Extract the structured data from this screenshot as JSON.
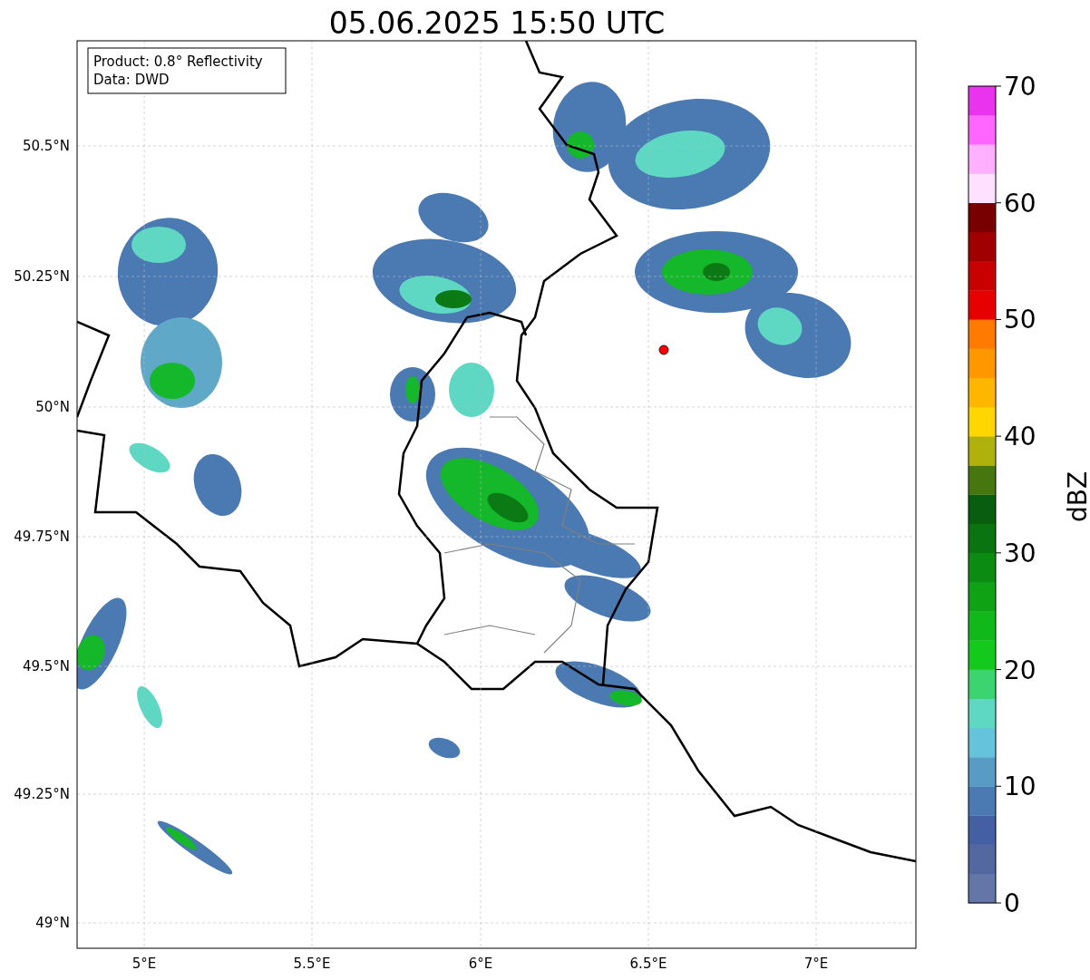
{
  "title": "05.06.2025 15:50 UTC",
  "info_box": [
    "Product: 0.8° Reflectivity",
    "Data: DWD"
  ],
  "x_ticks": [
    "5°E",
    "5.5°E",
    "6°E",
    "6.5°E",
    "7°E"
  ],
  "y_ticks": [
    "50.5°N",
    "50.25°N",
    "50°N",
    "49.75°N",
    "49.5°N",
    "49.25°N",
    "49°N"
  ],
  "colorbar": {
    "label": "dBZ",
    "ticks": [
      "70",
      "60",
      "50",
      "40",
      "30",
      "20",
      "10",
      "0"
    ],
    "bins": [
      {
        "color": "#6475a8"
      },
      {
        "color": "#5367a1"
      },
      {
        "color": "#4460a3"
      },
      {
        "color": "#4b79b2"
      },
      {
        "color": "#589cc5"
      },
      {
        "color": "#66c3dc"
      },
      {
        "color": "#5fd8c3"
      },
      {
        "color": "#3cd46e"
      },
      {
        "color": "#13c91c"
      },
      {
        "color": "#10b81a"
      },
      {
        "color": "#0fa215"
      },
      {
        "color": "#0c8b13"
      },
      {
        "color": "#0a7411"
      },
      {
        "color": "#085d0e"
      },
      {
        "color": "#47760e"
      },
      {
        "color": "#b0b10a"
      },
      {
        "color": "#ffd600"
      },
      {
        "color": "#ffb600"
      },
      {
        "color": "#ff9800"
      },
      {
        "color": "#ff7a00"
      },
      {
        "color": "#e60000"
      },
      {
        "color": "#c80000"
      },
      {
        "color": "#a00000"
      },
      {
        "color": "#780000"
      },
      {
        "color": "#ffe0ff"
      },
      {
        "color": "#ffb0ff"
      },
      {
        "color": "#ff66ff"
      },
      {
        "color": "#e933ee"
      }
    ]
  }
}
